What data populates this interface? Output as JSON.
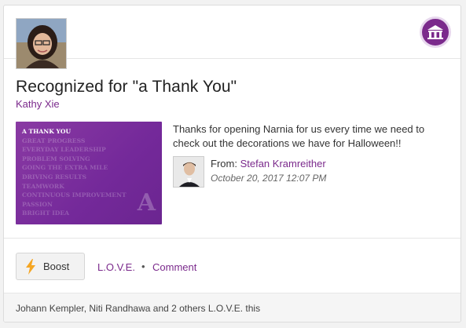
{
  "recognition": {
    "title": "Recognized for \"a Thank You\"",
    "recipient_name": "Kathy Xie",
    "award_image": {
      "title": "A THANK YOU",
      "values": [
        "GREAT PROGRESS",
        "EVERYDAY LEADERSHIP",
        "PROBLEM SOLVING",
        "GOING THE EXTRA MILE",
        "DRIVING RESULTS",
        "TEAMWORK",
        "CONTINUOUS IMPROVEMENT",
        "PASSION",
        "BRIGHT IDEA"
      ],
      "logo_letter": "A"
    },
    "message": "Thanks for opening Narnia for us every time we need to check out the decorations we have for Halloween!!",
    "sender": {
      "from_label": "From:",
      "name": "Stefan Kramreither",
      "date": "October 20, 2017 12:07 PM"
    }
  },
  "actions": {
    "boost_label": "Boost",
    "love_label": "L.O.V.E.",
    "separator": "•",
    "comment_label": "Comment"
  },
  "footer": {
    "love_summary": "Johann Kempler, Niti Randhawa and 2 others L.O.V.E. this"
  },
  "icons": {
    "logo": "award-building-icon",
    "boost": "lightning-bolt-icon"
  },
  "colors": {
    "brand_purple": "#7b2a8c",
    "boost_icon": "#f5a623"
  }
}
